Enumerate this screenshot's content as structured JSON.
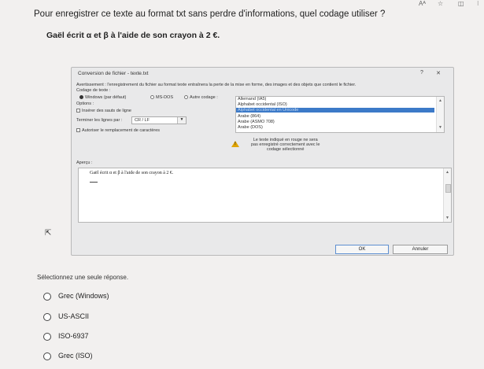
{
  "question": "Pour enregistrer ce texte au format txt sans perdre d'informations, quel codage utiliser ?",
  "statement": "Gaël écrit α et β à l'aide de son crayon à 2 €.",
  "dialog": {
    "title": "Conversion de fichier - texte.txt",
    "help_label": "?",
    "close_label": "✕",
    "warning": "Avertissement : l'enregistrement du fichier au format texte entraînera la perte de la mise en forme, des images et des objets que contient le fichier.",
    "encoding_label": "Codage de texte :",
    "windows_option": "Windows (par défaut)",
    "msdos_option": "MS-DOS",
    "other_option": "Autre codage :",
    "options_label": "Options :",
    "insert_breaks": "Insérer des sauts de ligne",
    "end_lines_label": "Terminer les lignes par :",
    "end_lines_value": "CR / LF",
    "allow_substitution": "Autoriser le remplacement de caractères",
    "encodings": [
      "Allemand (IA5)",
      "Alphabet occidental (ISO)",
      "Alphabet occidental en Unicode",
      "Arabe (864)",
      "Arabe (ASMO 708)",
      "Arabe (DOS)"
    ],
    "red_note_lines": [
      "Le texte indiqué en rouge ne sera",
      "pas enregistré correctement avec le",
      "codage sélectionné"
    ],
    "preview_label": "Aperçu :",
    "preview_text": "Gaël écrit α et β à l'aide de son crayon à 2 €.",
    "ok_label": "OK",
    "cancel_label": "Annuler",
    "warning_icon": "!"
  },
  "instruction": "Sélectionnez une seule réponse.",
  "choices": [
    "Grec (Windows)",
    "US-ASCII",
    "ISO-6937",
    "Grec (ISO)"
  ]
}
